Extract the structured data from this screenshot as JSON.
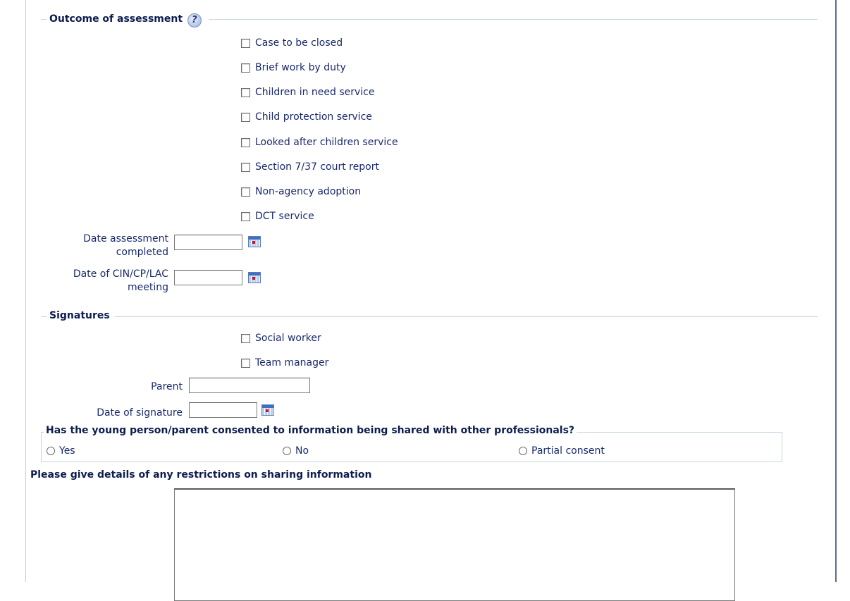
{
  "outcome": {
    "legend": "Outcome of assessment",
    "help_icon": "help-question-icon",
    "checkboxes": [
      {
        "label": "Case to be closed",
        "checked": false
      },
      {
        "label": "Brief work by duty",
        "checked": false
      },
      {
        "label": "Children in need service",
        "checked": false
      },
      {
        "label": "Child protection service",
        "checked": false
      },
      {
        "label": "Looked after children service",
        "checked": false
      },
      {
        "label": "Section 7/37 court report",
        "checked": false
      },
      {
        "label": "Non-agency adoption",
        "checked": false
      },
      {
        "label": "DCT service",
        "checked": false
      }
    ],
    "date_assessment_label_line1": "Date assessment",
    "date_assessment_label_line2": "completed",
    "date_assessment_value": "",
    "date_meeting_label_line1": "Date of CIN/CP/LAC",
    "date_meeting_label_line2": "meeting",
    "date_meeting_value": "",
    "calendar_icon": "calendar-icon"
  },
  "signatures": {
    "legend": "Signatures",
    "checkboxes": [
      {
        "label": "Social worker",
        "checked": false
      },
      {
        "label": "Team manager",
        "checked": false
      }
    ],
    "parent_label": "Parent",
    "parent_value": "",
    "date_signature_label": "Date of signature",
    "date_signature_value": ""
  },
  "consent": {
    "question": "Has the young person/parent consented to information being shared with other professionals?",
    "options": [
      {
        "label": "Yes",
        "selected": false
      },
      {
        "label": "No",
        "selected": false
      },
      {
        "label": "Partial consent",
        "selected": false
      }
    ]
  },
  "restrictions": {
    "heading": "Please give details of any restrictions on sharing information",
    "value": ""
  }
}
